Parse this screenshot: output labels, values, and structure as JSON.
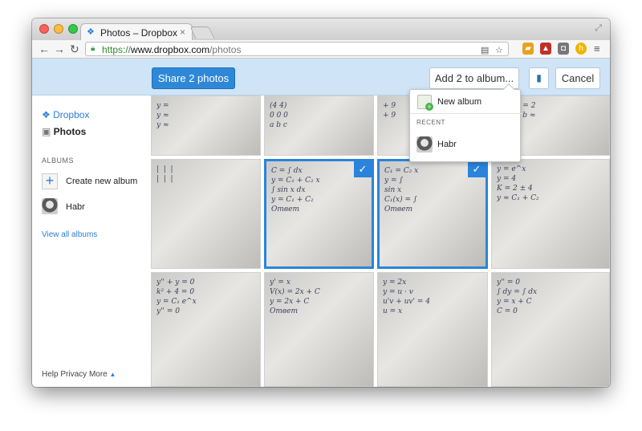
{
  "browser": {
    "tab_title": "Photos – Dropbox",
    "url_scheme": "https://",
    "url_host": "www.dropbox.com",
    "url_path": "/photos"
  },
  "actions": {
    "share_label": "Share 2 photos",
    "add_to_album_label": "Add 2 to album...",
    "cancel_label": "Cancel"
  },
  "dropdown": {
    "new_album": "New album",
    "recent_heading": "RECENT",
    "recent_album": "Habr"
  },
  "sidebar": {
    "dropbox": "Dropbox",
    "photos": "Photos",
    "albums_heading": "ALBUMS",
    "create_album": "Create new album",
    "album_habr": "Habr",
    "view_all": "View all albums"
  },
  "footer": {
    "help": "Help",
    "privacy": "Privacy",
    "more": "More"
  },
  "colors": {
    "accent": "#2a84dc",
    "action_bar": "#cfe4f6"
  }
}
